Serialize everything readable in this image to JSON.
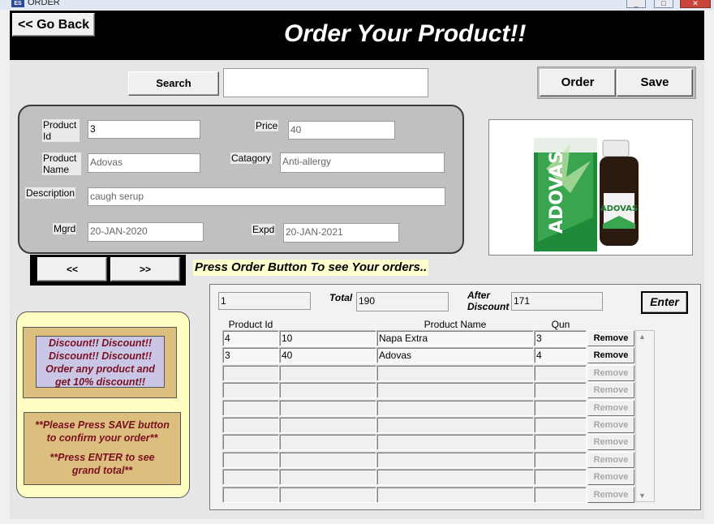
{
  "window": {
    "title": "ORDER",
    "icon_text": "ES",
    "controls": [
      "_",
      "□",
      "✕"
    ]
  },
  "header": {
    "back_label": "<< Go Back",
    "title": "Order Your Product!!"
  },
  "search": {
    "button_label": "Search",
    "value": ""
  },
  "actions": {
    "order_label": "Order",
    "save_label": "Save"
  },
  "product": {
    "id_label": "Product Id",
    "id_value": "3",
    "price_label": "Price",
    "price_value": "40",
    "name_label": "Product Name",
    "name_value": "Adovas",
    "category_label": "Catagory",
    "category_value": "Anti-allergy",
    "description_label": "Description",
    "description_value": "caugh serup",
    "mfg_label": "Mgrd",
    "mfg_value": "20-JAN-2020",
    "exp_label": "Expd",
    "exp_value": "20-JAN-2021"
  },
  "image": {
    "brand": "ADOVAS",
    "alt": "product-image"
  },
  "nav": {
    "prev_label": "<<",
    "next_label": ">>"
  },
  "message": "Press Order Button To see Your orders..",
  "promo": {
    "lines": [
      "Discount!!   Discount!!",
      "Discount!!   Discount!!",
      "Order any product and",
      "get 10% discount!!"
    ],
    "note1": [
      "**Please Press SAVE button",
      "to confirm your order**"
    ],
    "note2": [
      "**Press ENTER to see",
      "grand total**"
    ]
  },
  "orders": {
    "count_value": "1",
    "total_label": "Total",
    "total_value": "190",
    "after_label": "After Discount",
    "after_value": "171",
    "enter_label": "Enter",
    "columns": [
      "Product Id",
      "Product Name",
      "Qun"
    ],
    "remove_label": "Remove",
    "rows": [
      {
        "c1": "4",
        "c2": "10",
        "name": "Napa Extra",
        "qty": "3"
      },
      {
        "c1": "3",
        "c2": "40",
        "name": "Adovas",
        "qty": "4"
      },
      {
        "c1": "",
        "c2": "",
        "name": "",
        "qty": ""
      },
      {
        "c1": "",
        "c2": "",
        "name": "",
        "qty": ""
      },
      {
        "c1": "",
        "c2": "",
        "name": "",
        "qty": ""
      },
      {
        "c1": "",
        "c2": "",
        "name": "",
        "qty": ""
      },
      {
        "c1": "",
        "c2": "",
        "name": "",
        "qty": ""
      },
      {
        "c1": "",
        "c2": "",
        "name": "",
        "qty": ""
      },
      {
        "c1": "",
        "c2": "",
        "name": "",
        "qty": ""
      },
      {
        "c1": "",
        "c2": "",
        "name": "",
        "qty": ""
      }
    ]
  }
}
